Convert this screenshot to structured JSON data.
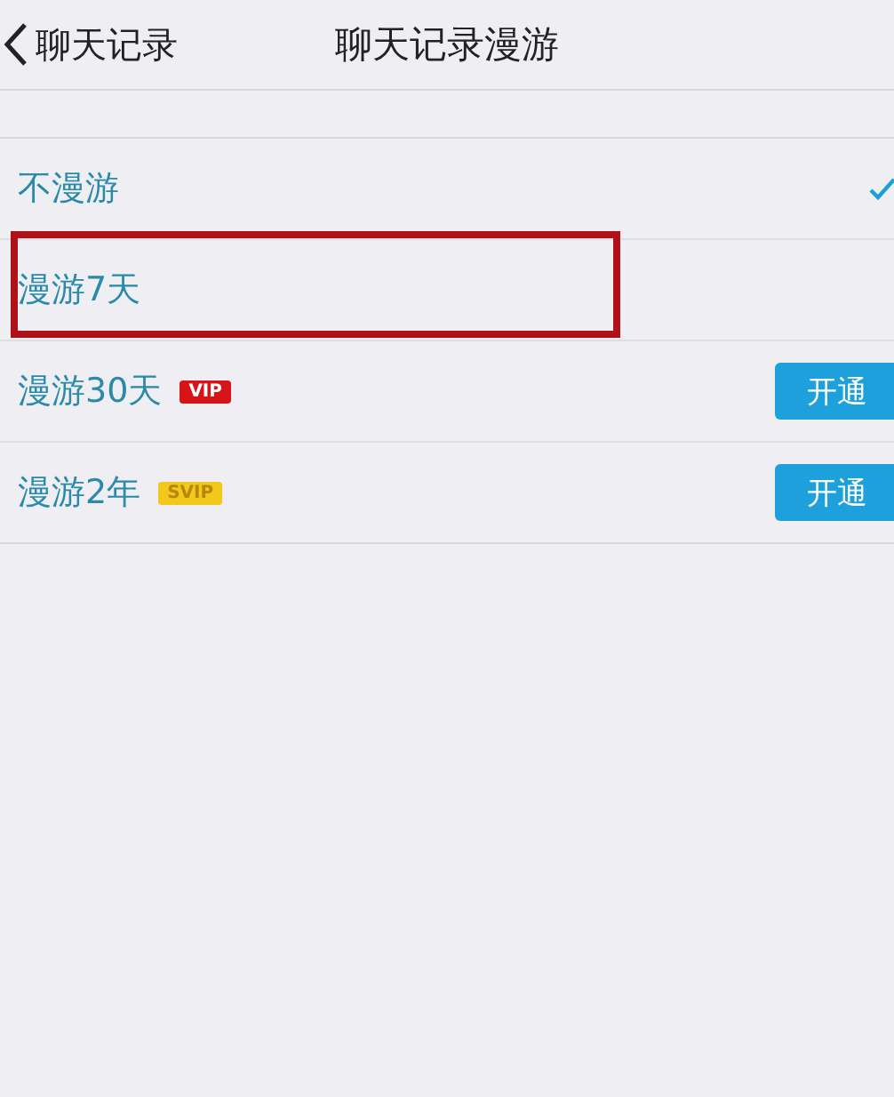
{
  "nav": {
    "back_label": "聊天记录",
    "title": "聊天记录漫游"
  },
  "options": [
    {
      "label": "不漫游",
      "selected": true,
      "highlighted": false
    },
    {
      "label": "漫游7天",
      "selected": false,
      "highlighted": true
    },
    {
      "label": "漫游30天",
      "selected": false,
      "highlighted": false,
      "badge": {
        "text": "VIP",
        "color": "#d7141a"
      },
      "button": "开通"
    },
    {
      "label": "漫游2年",
      "selected": false,
      "highlighted": false,
      "badge": {
        "text": "SVIP",
        "color": "#f2c81c"
      },
      "button": "开通"
    }
  ]
}
